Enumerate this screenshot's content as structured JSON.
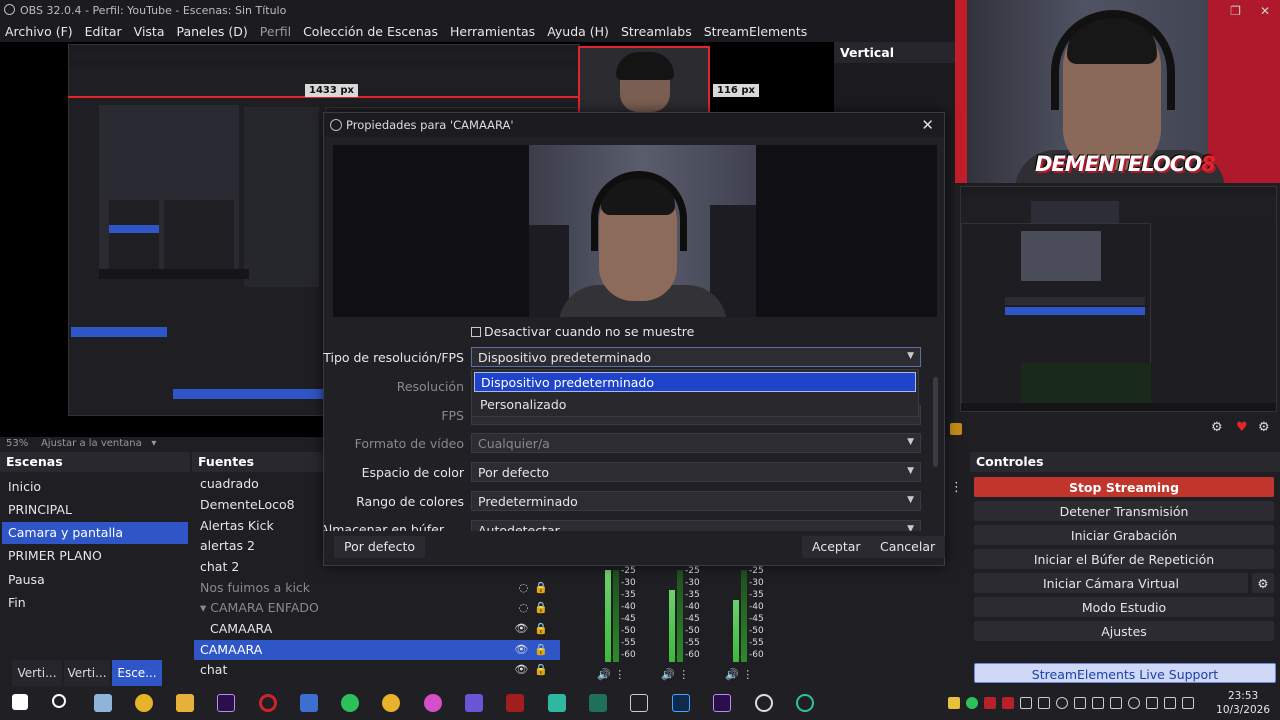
{
  "window": {
    "title": "OBS 32.0.4 - Perfil: YouTube - Escenas: Sin Título"
  },
  "menu": {
    "items": [
      "Archivo (F)",
      "Editar",
      "Vista",
      "Paneles (D)",
      "Perfil",
      "Colección de Escenas",
      "Herramientas",
      "Ayuda (H)",
      "Streamlabs",
      "StreamElements"
    ]
  },
  "preview": {
    "px_width_label": "1433 px",
    "px_height_label": "116 px",
    "nested_px_label": "116 px"
  },
  "vertical": {
    "title": "Vertical"
  },
  "webcam": {
    "brand_main": "DEMENTELOCO",
    "brand_num": "8"
  },
  "zoom": {
    "percent": "53%",
    "fit_label": "Ajustar a la ventana"
  },
  "scenes": {
    "title": "Escenas",
    "items": [
      {
        "label": "Inicio",
        "selected": false
      },
      {
        "label": "PRINCIPAL",
        "selected": false
      },
      {
        "label": "Camara y pantalla",
        "selected": true
      },
      {
        "label": "PRIMER PLANO",
        "selected": false
      },
      {
        "label": "Pausa",
        "selected": false
      },
      {
        "label": "Fin",
        "selected": false
      }
    ]
  },
  "sources": {
    "title": "Fuentes",
    "items": [
      {
        "label": "cuadrado"
      },
      {
        "label": "DementeLoco8"
      },
      {
        "label": "Alertas Kick"
      },
      {
        "label": "alertas 2"
      },
      {
        "label": "chat 2"
      },
      {
        "label": "Nos fuimos a kick"
      },
      {
        "label": "CAMARA ENFADO"
      },
      {
        "label": "CAMAARA"
      },
      {
        "label": "CAMAARA"
      },
      {
        "label": "chat"
      }
    ]
  },
  "bottom_tabs": [
    "Verti...",
    "Verti...",
    "Esce..."
  ],
  "mixer": {
    "db_ticks": [
      "-25",
      "-30",
      "-35",
      "-40",
      "-45",
      "-50",
      "-55",
      "-60"
    ]
  },
  "controls": {
    "title": "Controles",
    "buttons": [
      "Stop Streaming",
      "Detener Transmisión",
      "Iniciar Grabación",
      "Iniciar el Búfer de Repetición",
      "Iniciar Cámara Virtual",
      "Modo Estudio",
      "Ajustes"
    ],
    "support": "StreamElements Live Support"
  },
  "dialog": {
    "title": "Propiedades para 'CAMAARA'",
    "checkbox_label": "Desactivar cuando no se muestre",
    "rows": {
      "res_type_label": "Tipo de resolución/FPS",
      "res_type_value": "Dispositivo predeterminado",
      "resolution_label": "Resolución",
      "fps_label": "FPS",
      "video_format_label": "Formato de vídeo",
      "video_format_value": "Cualquier/a",
      "color_space_label": "Espacio de color",
      "color_space_value": "Por defecto",
      "color_range_label": "Rango de colores",
      "color_range_value": "Predeterminado",
      "buffer_label": "Almacenar en búfer",
      "buffer_value": "Autodetectar"
    },
    "dropdown_options": [
      "Dispositivo predeterminado",
      "Personalizado"
    ],
    "buttons": {
      "defaults": "Por defecto",
      "accept": "Aceptar",
      "cancel": "Cancelar"
    }
  },
  "taskbar": {
    "time": "23:53",
    "date": "10/3/2026"
  },
  "colors": {
    "accent": "#2f56c6",
    "stop_streaming": "#c0362c",
    "selection_red": "#e0262b"
  }
}
